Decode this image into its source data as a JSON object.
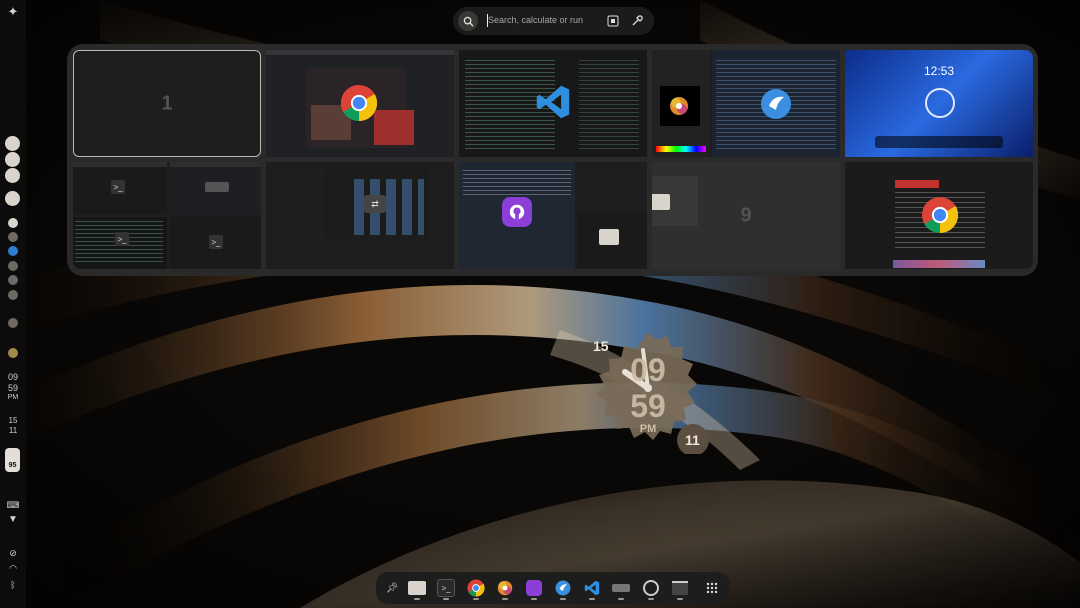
{
  "search": {
    "placeholder": "Search, calculate or run"
  },
  "sidebar": {
    "clock_hour": "09",
    "clock_minute": "59",
    "clock_ampm": "PM",
    "date_day": "15",
    "date_month": "11",
    "battery_level": "95"
  },
  "overview": {
    "workspaces": [
      {
        "id": "1",
        "label": "1"
      },
      {
        "id": "9",
        "label": "9"
      }
    ],
    "lockscreen_time": "12:53"
  },
  "desktop_clock": {
    "hour": "09",
    "minute": "59",
    "ampm": "PM",
    "day": "15",
    "month": "11"
  },
  "dock": {
    "apps": [
      "pin",
      "file-manager",
      "terminal",
      "chrome",
      "color-picker",
      "github-desktop",
      "qbittorrent",
      "vscode",
      "terminal-tiles",
      "webcam",
      "mixer",
      "app-grid"
    ]
  },
  "colors": {
    "accent": "#d8ccb8",
    "clock_face": "#7a6a57",
    "panel": "#2a2a2a"
  }
}
